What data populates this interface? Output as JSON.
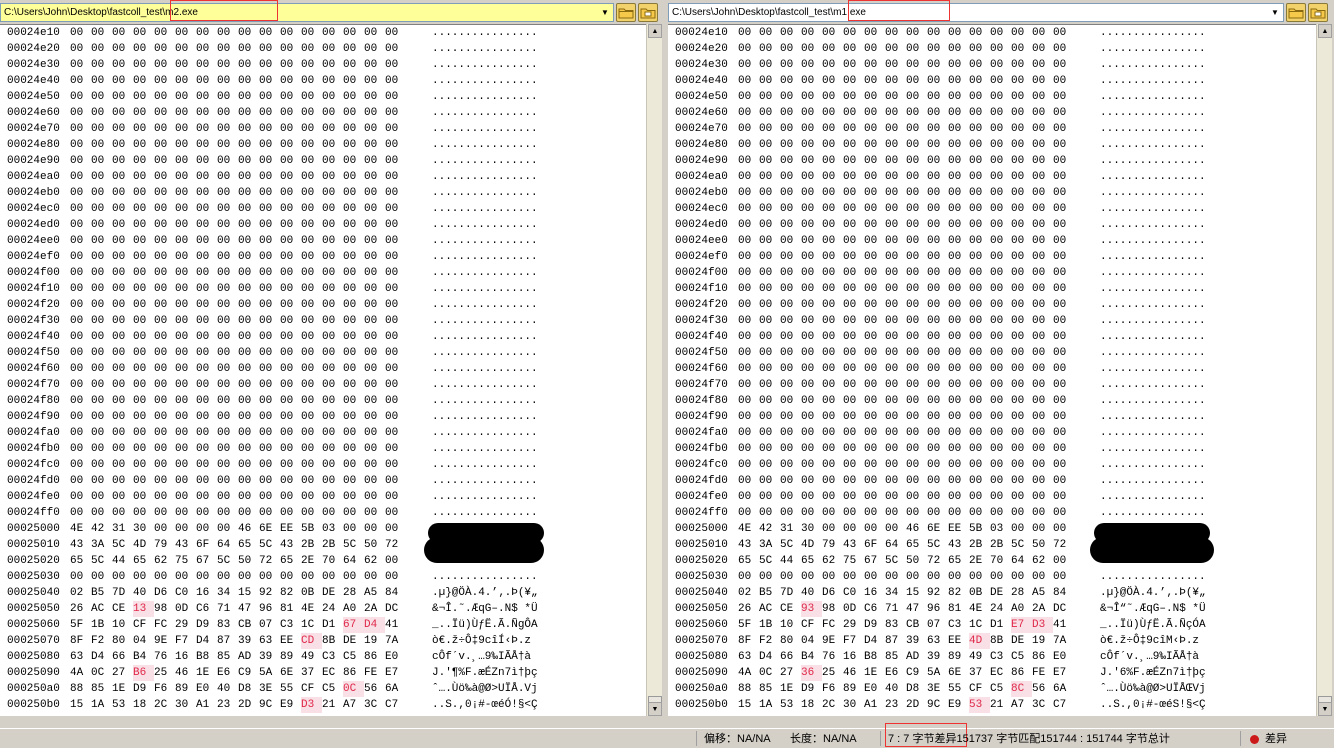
{
  "panes": [
    {
      "path": "C:\\Users\\John\\Desktop\\fastcoll_test\\m2.exe",
      "rows": [
        {
          "o": "00024e10",
          "b": "00 00 00 00 00 00 00 00 00 00 00 00 00 00 00 00",
          "a": "................"
        },
        {
          "o": "00024e20",
          "b": "00 00 00 00 00 00 00 00 00 00 00 00 00 00 00 00",
          "a": "................"
        },
        {
          "o": "00024e30",
          "b": "00 00 00 00 00 00 00 00 00 00 00 00 00 00 00 00",
          "a": "................"
        },
        {
          "o": "00024e40",
          "b": "00 00 00 00 00 00 00 00 00 00 00 00 00 00 00 00",
          "a": "................"
        },
        {
          "o": "00024e50",
          "b": "00 00 00 00 00 00 00 00 00 00 00 00 00 00 00 00",
          "a": "................"
        },
        {
          "o": "00024e60",
          "b": "00 00 00 00 00 00 00 00 00 00 00 00 00 00 00 00",
          "a": "................"
        },
        {
          "o": "00024e70",
          "b": "00 00 00 00 00 00 00 00 00 00 00 00 00 00 00 00",
          "a": "................"
        },
        {
          "o": "00024e80",
          "b": "00 00 00 00 00 00 00 00 00 00 00 00 00 00 00 00",
          "a": "................"
        },
        {
          "o": "00024e90",
          "b": "00 00 00 00 00 00 00 00 00 00 00 00 00 00 00 00",
          "a": "................"
        },
        {
          "o": "00024ea0",
          "b": "00 00 00 00 00 00 00 00 00 00 00 00 00 00 00 00",
          "a": "................"
        },
        {
          "o": "00024eb0",
          "b": "00 00 00 00 00 00 00 00 00 00 00 00 00 00 00 00",
          "a": "................"
        },
        {
          "o": "00024ec0",
          "b": "00 00 00 00 00 00 00 00 00 00 00 00 00 00 00 00",
          "a": "................"
        },
        {
          "o": "00024ed0",
          "b": "00 00 00 00 00 00 00 00 00 00 00 00 00 00 00 00",
          "a": "................"
        },
        {
          "o": "00024ee0",
          "b": "00 00 00 00 00 00 00 00 00 00 00 00 00 00 00 00",
          "a": "................"
        },
        {
          "o": "00024ef0",
          "b": "00 00 00 00 00 00 00 00 00 00 00 00 00 00 00 00",
          "a": "................"
        },
        {
          "o": "00024f00",
          "b": "00 00 00 00 00 00 00 00 00 00 00 00 00 00 00 00",
          "a": "................"
        },
        {
          "o": "00024f10",
          "b": "00 00 00 00 00 00 00 00 00 00 00 00 00 00 00 00",
          "a": "................"
        },
        {
          "o": "00024f20",
          "b": "00 00 00 00 00 00 00 00 00 00 00 00 00 00 00 00",
          "a": "................"
        },
        {
          "o": "00024f30",
          "b": "00 00 00 00 00 00 00 00 00 00 00 00 00 00 00 00",
          "a": "................"
        },
        {
          "o": "00024f40",
          "b": "00 00 00 00 00 00 00 00 00 00 00 00 00 00 00 00",
          "a": "................"
        },
        {
          "o": "00024f50",
          "b": "00 00 00 00 00 00 00 00 00 00 00 00 00 00 00 00",
          "a": "................"
        },
        {
          "o": "00024f60",
          "b": "00 00 00 00 00 00 00 00 00 00 00 00 00 00 00 00",
          "a": "................"
        },
        {
          "o": "00024f70",
          "b": "00 00 00 00 00 00 00 00 00 00 00 00 00 00 00 00",
          "a": "................"
        },
        {
          "o": "00024f80",
          "b": "00 00 00 00 00 00 00 00 00 00 00 00 00 00 00 00",
          "a": "................"
        },
        {
          "o": "00024f90",
          "b": "00 00 00 00 00 00 00 00 00 00 00 00 00 00 00 00",
          "a": "................"
        },
        {
          "o": "00024fa0",
          "b": "00 00 00 00 00 00 00 00 00 00 00 00 00 00 00 00",
          "a": "................"
        },
        {
          "o": "00024fb0",
          "b": "00 00 00 00 00 00 00 00 00 00 00 00 00 00 00 00",
          "a": "................"
        },
        {
          "o": "00024fc0",
          "b": "00 00 00 00 00 00 00 00 00 00 00 00 00 00 00 00",
          "a": "................"
        },
        {
          "o": "00024fd0",
          "b": "00 00 00 00 00 00 00 00 00 00 00 00 00 00 00 00",
          "a": "................"
        },
        {
          "o": "00024fe0",
          "b": "00 00 00 00 00 00 00 00 00 00 00 00 00 00 00 00",
          "a": "................"
        },
        {
          "o": "00024ff0",
          "b": "00 00 00 00 00 00 00 00 00 00 00 00 00 00 00 00",
          "a": "................"
        },
        {
          "o": "00025000",
          "b": "4E 42 31 30 00 00 00 00 46 6E EE 5B 03 00 00 00",
          "a": ""
        },
        {
          "o": "00025010",
          "b": "43 3A 5C 4D 79 43 6F 64 65 5C 43 2B 2B 5C 50 72",
          "a": ""
        },
        {
          "o": "00025020",
          "b": "65 5C 44 65 62 75 67 5C 50 72 65 2E 70 64 62 00",
          "a": ""
        },
        {
          "o": "00025030",
          "b": "00 00 00 00 00 00 00 00 00 00 00 00 00 00 00 00",
          "a": "................"
        },
        {
          "o": "00025040",
          "b": "02 B5 7D 40 D6 C0 16 34 15 92 82 0B DE 28 A5 84",
          "a": ".µ}@ÖÀ.4.’‚.Þ(¥„"
        },
        {
          "o": "00025050",
          "b": "26 AC CE 13 98 0D C6 71 47 96 81 4E 24 A0 2A DC",
          "a": "&¬Î.˜.ÆqG–.N$ *Ü"
        },
        {
          "o": "00025060",
          "b": "5F 1B 10 CF FC 29 D9 83 CB 07 C3 1C D1 67 D4 41",
          "a": "_..Ïü)ÙƒË.Ã.ÑgÔA"
        },
        {
          "o": "00025070",
          "b": "8F F2 80 04 9E F7 D4 87 39 63 EE CD 8B DE 19 7A",
          "a": "ò€.ž÷Ô‡9cîÍ‹Þ.z"
        },
        {
          "o": "00025080",
          "b": "63 D4 66 B4 76 16 B8 85 AD 39 89 49 C3 C5 86 E0",
          "a": "cÔf´v.¸…­9‰IÃÅ†à"
        },
        {
          "o": "00025090",
          "b": "4A 0C 27 B6 25 46 1E E6 C9 5A 6E 37 EC 86 FE E7",
          "a": "J.'¶%F.æÉZn7ì†þç"
        },
        {
          "o": "000250a0",
          "b": "88 85 1E D9 F6 89 E0 40 D8 3E 55 CF C5 0C 56 6A",
          "a": "ˆ….Ùö‰à@Ø>UÏÅ.Vj"
        },
        {
          "o": "000250b0",
          "b": "15 1A 53 18 2C 30 A1 23 2D 9C E9 D3 21 A7 3C C7",
          "a": "..S.,0¡#-œéÓ!§<Ç"
        }
      ]
    },
    {
      "path": "C:\\Users\\John\\Desktop\\fastcoll_test\\m1.exe",
      "rows": [
        {
          "o": "00024e10",
          "b": "00 00 00 00 00 00 00 00 00 00 00 00 00 00 00 00",
          "a": "................"
        },
        {
          "o": "00024e20",
          "b": "00 00 00 00 00 00 00 00 00 00 00 00 00 00 00 00",
          "a": "................"
        },
        {
          "o": "00024e30",
          "b": "00 00 00 00 00 00 00 00 00 00 00 00 00 00 00 00",
          "a": "................"
        },
        {
          "o": "00024e40",
          "b": "00 00 00 00 00 00 00 00 00 00 00 00 00 00 00 00",
          "a": "................"
        },
        {
          "o": "00024e50",
          "b": "00 00 00 00 00 00 00 00 00 00 00 00 00 00 00 00",
          "a": "................"
        },
        {
          "o": "00024e60",
          "b": "00 00 00 00 00 00 00 00 00 00 00 00 00 00 00 00",
          "a": "................"
        },
        {
          "o": "00024e70",
          "b": "00 00 00 00 00 00 00 00 00 00 00 00 00 00 00 00",
          "a": "................"
        },
        {
          "o": "00024e80",
          "b": "00 00 00 00 00 00 00 00 00 00 00 00 00 00 00 00",
          "a": "................"
        },
        {
          "o": "00024e90",
          "b": "00 00 00 00 00 00 00 00 00 00 00 00 00 00 00 00",
          "a": "................"
        },
        {
          "o": "00024ea0",
          "b": "00 00 00 00 00 00 00 00 00 00 00 00 00 00 00 00",
          "a": "................"
        },
        {
          "o": "00024eb0",
          "b": "00 00 00 00 00 00 00 00 00 00 00 00 00 00 00 00",
          "a": "................"
        },
        {
          "o": "00024ec0",
          "b": "00 00 00 00 00 00 00 00 00 00 00 00 00 00 00 00",
          "a": "................"
        },
        {
          "o": "00024ed0",
          "b": "00 00 00 00 00 00 00 00 00 00 00 00 00 00 00 00",
          "a": "................"
        },
        {
          "o": "00024ee0",
          "b": "00 00 00 00 00 00 00 00 00 00 00 00 00 00 00 00",
          "a": "................"
        },
        {
          "o": "00024ef0",
          "b": "00 00 00 00 00 00 00 00 00 00 00 00 00 00 00 00",
          "a": "................"
        },
        {
          "o": "00024f00",
          "b": "00 00 00 00 00 00 00 00 00 00 00 00 00 00 00 00",
          "a": "................"
        },
        {
          "o": "00024f10",
          "b": "00 00 00 00 00 00 00 00 00 00 00 00 00 00 00 00",
          "a": "................"
        },
        {
          "o": "00024f20",
          "b": "00 00 00 00 00 00 00 00 00 00 00 00 00 00 00 00",
          "a": "................"
        },
        {
          "o": "00024f30",
          "b": "00 00 00 00 00 00 00 00 00 00 00 00 00 00 00 00",
          "a": "................"
        },
        {
          "o": "00024f40",
          "b": "00 00 00 00 00 00 00 00 00 00 00 00 00 00 00 00",
          "a": "................"
        },
        {
          "o": "00024f50",
          "b": "00 00 00 00 00 00 00 00 00 00 00 00 00 00 00 00",
          "a": "................"
        },
        {
          "o": "00024f60",
          "b": "00 00 00 00 00 00 00 00 00 00 00 00 00 00 00 00",
          "a": "................"
        },
        {
          "o": "00024f70",
          "b": "00 00 00 00 00 00 00 00 00 00 00 00 00 00 00 00",
          "a": "................"
        },
        {
          "o": "00024f80",
          "b": "00 00 00 00 00 00 00 00 00 00 00 00 00 00 00 00",
          "a": "................"
        },
        {
          "o": "00024f90",
          "b": "00 00 00 00 00 00 00 00 00 00 00 00 00 00 00 00",
          "a": "................"
        },
        {
          "o": "00024fa0",
          "b": "00 00 00 00 00 00 00 00 00 00 00 00 00 00 00 00",
          "a": "................"
        },
        {
          "o": "00024fb0",
          "b": "00 00 00 00 00 00 00 00 00 00 00 00 00 00 00 00",
          "a": "................"
        },
        {
          "o": "00024fc0",
          "b": "00 00 00 00 00 00 00 00 00 00 00 00 00 00 00 00",
          "a": "................"
        },
        {
          "o": "00024fd0",
          "b": "00 00 00 00 00 00 00 00 00 00 00 00 00 00 00 00",
          "a": "................"
        },
        {
          "o": "00024fe0",
          "b": "00 00 00 00 00 00 00 00 00 00 00 00 00 00 00 00",
          "a": "................"
        },
        {
          "o": "00024ff0",
          "b": "00 00 00 00 00 00 00 00 00 00 00 00 00 00 00 00",
          "a": "................"
        },
        {
          "o": "00025000",
          "b": "4E 42 31 30 00 00 00 00 46 6E EE 5B 03 00 00 00",
          "a": ""
        },
        {
          "o": "00025010",
          "b": "43 3A 5C 4D 79 43 6F 64 65 5C 43 2B 2B 5C 50 72",
          "a": ""
        },
        {
          "o": "00025020",
          "b": "65 5C 44 65 62 75 67 5C 50 72 65 2E 70 64 62 00",
          "a": ""
        },
        {
          "o": "00025030",
          "b": "00 00 00 00 00 00 00 00 00 00 00 00 00 00 00 00",
          "a": "................"
        },
        {
          "o": "00025040",
          "b": "02 B5 7D 40 D6 C0 16 34 15 92 82 0B DE 28 A5 84",
          "a": ".µ}@ÖÀ.4.’‚.Þ(¥„"
        },
        {
          "o": "00025050",
          "b": "26 AC CE 93 98 0D C6 71 47 96 81 4E 24 A0 2A DC",
          "a": "&¬Î“˜.ÆqG–.N$ *Ü"
        },
        {
          "o": "00025060",
          "b": "5F 1B 10 CF FC 29 D9 83 CB 07 C3 1C D1 E7 D3 41",
          "a": "_..Ïü)ÙƒË.Ã.ÑçÓA"
        },
        {
          "o": "00025070",
          "b": "8F F2 80 04 9E F7 D4 87 39 63 EE 4D 8B DE 19 7A",
          "a": "ò€.ž÷Ô‡9cîM‹Þ.z"
        },
        {
          "o": "00025080",
          "b": "63 D4 66 B4 76 16 B8 85 AD 39 89 49 C3 C5 86 E0",
          "a": "cÔf´v.¸…­9‰IÃÅ†à"
        },
        {
          "o": "00025090",
          "b": "4A 0C 27 36 25 46 1E E6 C9 5A 6E 37 EC 86 FE E7",
          "a": "J.'6%F.æÉZn7ì†þç"
        },
        {
          "o": "000250a0",
          "b": "88 85 1E D9 F6 89 E0 40 D8 3E 55 CF C5 8C 56 6A",
          "a": "ˆ….Ùö‰à@Ø>UÏÅŒVj"
        },
        {
          "o": "000250b0",
          "b": "15 1A 53 18 2C 30 A1 23 2D 9C E9 53 21 A7 3C C7",
          "a": "..S.,0¡#-œéS!§<Ç"
        }
      ]
    }
  ],
  "diff_bytes": [
    {
      "row": "00025050",
      "col": 3
    },
    {
      "row": "00025060",
      "col": 13
    },
    {
      "row": "00025060",
      "col": 14
    },
    {
      "row": "00025070",
      "col": 11
    },
    {
      "row": "00025090",
      "col": 3
    },
    {
      "row": "000250a0",
      "col": 13
    },
    {
      "row": "000250b0",
      "col": 11
    }
  ],
  "status": {
    "offset": "偏移：NA/NA",
    "length": "长度：NA/NA",
    "summary": "7 : 7 字节差异151737 字节匹配151744 : 151744 字节总计",
    "diff_label": "差异"
  },
  "colors": {
    "diff_text": "#e0294a",
    "left_path_bg": "#ffff99",
    "annotation_box": "#e33"
  }
}
